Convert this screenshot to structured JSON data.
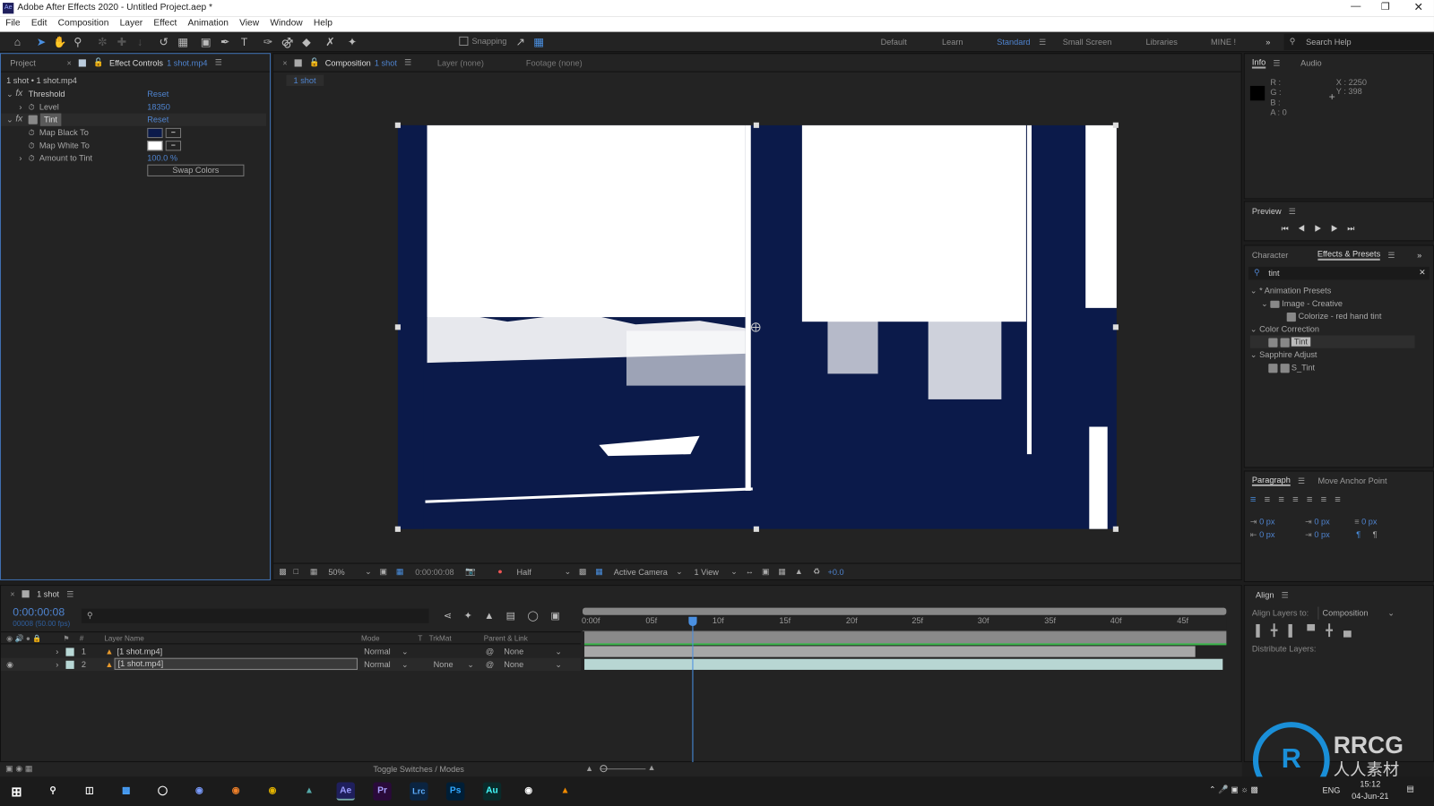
{
  "window": {
    "title": "Adobe After Effects 2020 - Untitled Project.aep *",
    "app_badge": "Ae"
  },
  "menu": [
    "File",
    "Edit",
    "Composition",
    "Layer",
    "Effect",
    "Animation",
    "View",
    "Window",
    "Help"
  ],
  "toolbar": {
    "snapping": "Snapping"
  },
  "workspaces": [
    "Default",
    "Learn",
    "Standard",
    "Small Screen",
    "Libraries",
    "MINE !"
  ],
  "workspace_active": "Standard",
  "search_help": "Search Help",
  "left_panel": {
    "tabs": {
      "project": "Project",
      "effect_controls": "Effect Controls",
      "layer_ref": "1 shot.mp4"
    },
    "breadcrumb": "1 shot • 1 shot.mp4",
    "effects": [
      {
        "name": "Threshold",
        "reset": "Reset",
        "params": [
          {
            "label": "Level",
            "value": "18350"
          }
        ]
      },
      {
        "name": "Tint",
        "reset": "Reset",
        "params": [
          {
            "label": "Map Black To",
            "color": "#0b1a4a"
          },
          {
            "label": "Map White To",
            "color": "#ffffff"
          },
          {
            "label": "Amount to Tint",
            "value": "100.0 %"
          }
        ]
      }
    ],
    "swap_colors": "Swap Colors"
  },
  "viewer": {
    "tabs": {
      "composition": "Composition",
      "comp_name": "1 shot",
      "layer": "Layer (none)",
      "footage": "Footage (none)"
    },
    "comp_tab": "1 shot",
    "zoom": "50%",
    "timecode": "0:00:00:08",
    "resolution": "Half",
    "camera": "Active Camera",
    "views": "1 View",
    "exposure": "+0.0",
    "colors": {
      "dark": "#0b1a4a",
      "light": "#ffffff"
    }
  },
  "info": {
    "tab": "Info",
    "audio_tab": "Audio",
    "r": "R :",
    "g": "G :",
    "b": "B :",
    "a": "A :  0",
    "x": "X : 2250",
    "y": "Y : 398"
  },
  "preview": {
    "title": "Preview"
  },
  "effects_presets": {
    "character_tab": "Character",
    "tab": "Effects & Presets",
    "search": "tint",
    "tree": [
      {
        "label": "* Animation Presets",
        "level": 0
      },
      {
        "label": "Image - Creative",
        "level": 1
      },
      {
        "label": "Colorize - red hand tint",
        "level": 2
      },
      {
        "label": "Color Correction",
        "level": 0
      },
      {
        "label": "Tint",
        "level": 1,
        "selected": true
      },
      {
        "label": "Sapphire Adjust",
        "level": 0
      },
      {
        "label": "S_Tint",
        "level": 1
      }
    ]
  },
  "paragraph": {
    "tab": "Paragraph",
    "move_anchor": "Move Anchor Point",
    "fields": [
      "0 px",
      "0 px",
      "0 px",
      "0 px",
      "0 px"
    ]
  },
  "align": {
    "title": "Align",
    "align_to_label": "Align Layers to:",
    "align_to": "Composition",
    "distribute": "Distribute Layers:"
  },
  "timeline": {
    "tab": "1 shot",
    "timecode": "0:00:00:08",
    "frame_info": "00008 (50.00 fps)",
    "columns": {
      "layer_name": "Layer Name",
      "mode": "Mode",
      "t": "T",
      "trkmat": "TrkMat",
      "parent": "Parent & Link"
    },
    "layers": [
      {
        "num": "1",
        "name": "[1 shot.mp4]",
        "mode": "Normal",
        "trkmat": "",
        "parent": "None"
      },
      {
        "num": "2",
        "name": "[1 shot.mp4]",
        "mode": "Normal",
        "trkmat": "None",
        "parent": "None"
      }
    ],
    "ruler": [
      "0:00f",
      "05f",
      "10f",
      "15f",
      "20f",
      "25f",
      "30f",
      "35f",
      "40f",
      "45f"
    ],
    "current_frame": 8,
    "fps_frames": 50,
    "toggle": "Toggle Switches / Modes"
  },
  "taskbar": {
    "lang": "ENG",
    "time": "15:12",
    "date": "04-Jun-21",
    "apps": [
      "Ae",
      "Pr",
      "Lrc",
      "Ps",
      "Au"
    ]
  },
  "watermark": {
    "text": "RRCG",
    "subtitle": "人人素材"
  }
}
